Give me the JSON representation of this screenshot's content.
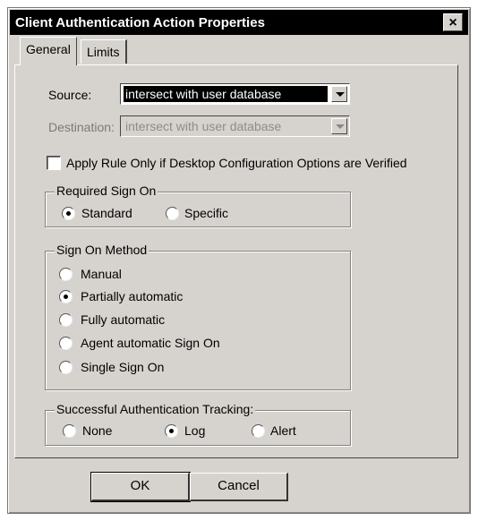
{
  "window": {
    "title": "Client Authentication Action Properties",
    "close_glyph": "×"
  },
  "tabs": [
    {
      "label": "General",
      "active": true
    },
    {
      "label": "Limits",
      "active": false
    }
  ],
  "source": {
    "label": "Source:",
    "value": "intersect with user database"
  },
  "destination": {
    "label": "Destination:",
    "value": "intersect with user database",
    "disabled": true
  },
  "apply_rule": {
    "label": "Apply Rule Only if Desktop Configuration Options are Verified",
    "checked": false
  },
  "required_sign_on": {
    "legend": "Required Sign On",
    "options": [
      {
        "label": "Standard",
        "checked": true
      },
      {
        "label": "Specific",
        "checked": false
      }
    ]
  },
  "sign_on_method": {
    "legend": "Sign On Method",
    "options": [
      {
        "label": "Manual",
        "checked": false
      },
      {
        "label": "Partially automatic",
        "checked": true
      },
      {
        "label": "Fully automatic",
        "checked": false
      },
      {
        "label": "Agent automatic Sign On",
        "checked": false
      },
      {
        "label": "Single Sign On",
        "checked": false
      }
    ]
  },
  "tracking": {
    "legend": "Successful Authentication Tracking:",
    "options": [
      {
        "label": "None",
        "checked": false
      },
      {
        "label": "Log",
        "checked": true
      },
      {
        "label": "Alert",
        "checked": false
      }
    ]
  },
  "buttons": {
    "ok": "OK",
    "cancel": "Cancel"
  }
}
